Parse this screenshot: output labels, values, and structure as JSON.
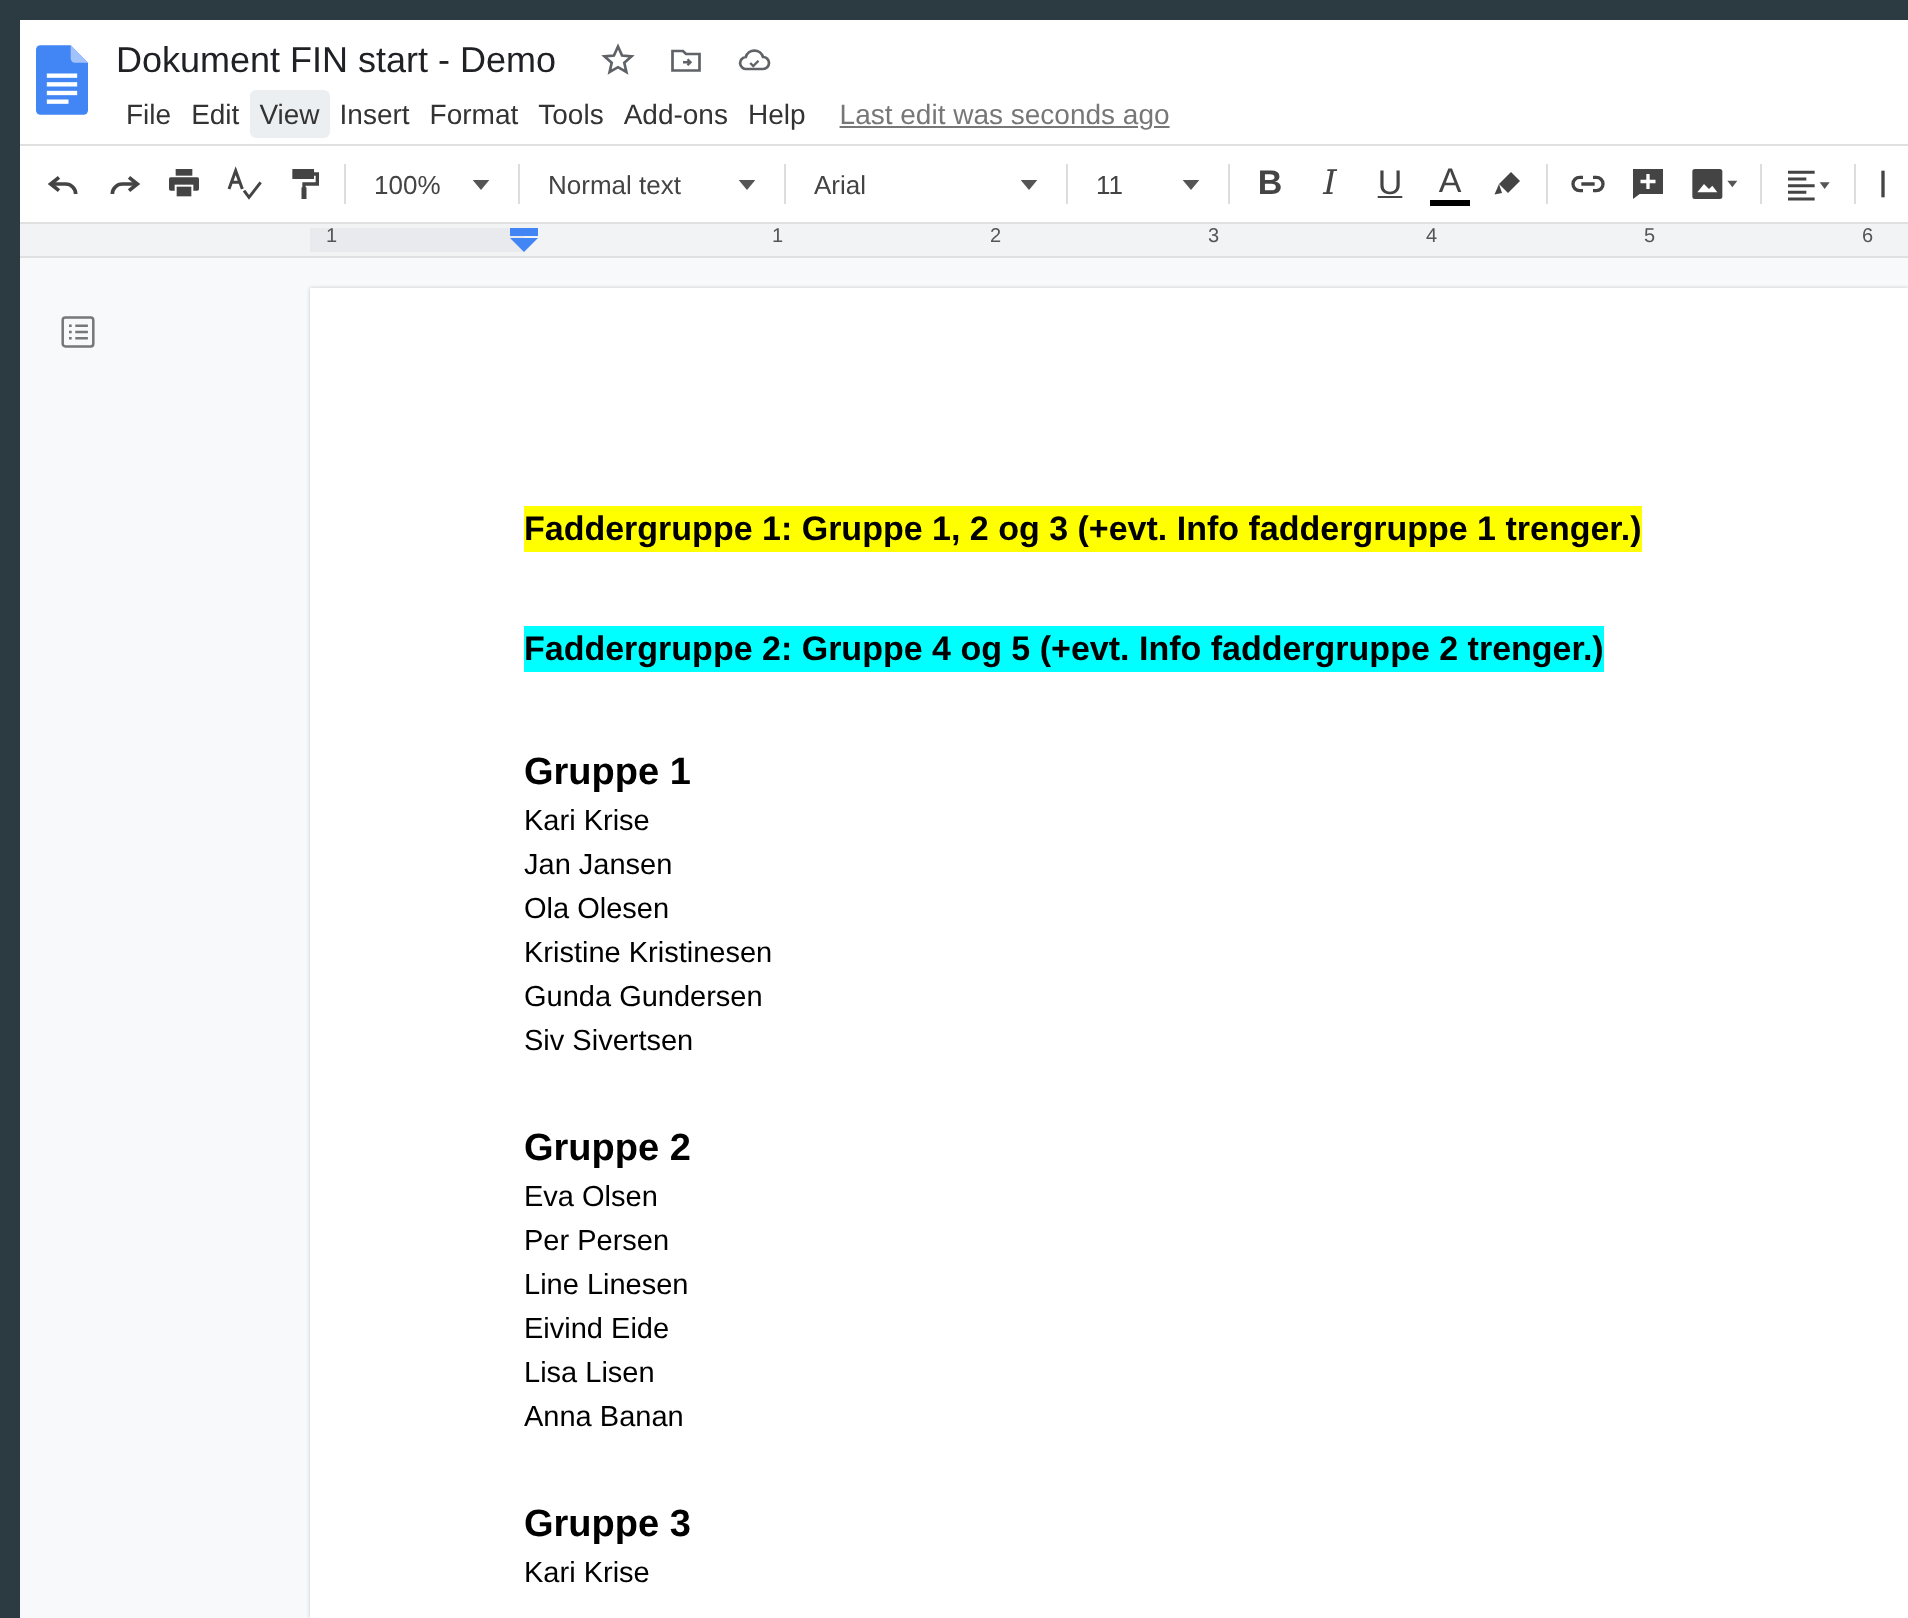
{
  "app": {
    "title": "Dokument FIN start - Demo"
  },
  "menu": [
    {
      "label": "File",
      "selected": false
    },
    {
      "label": "Edit",
      "selected": false
    },
    {
      "label": "View",
      "selected": true
    },
    {
      "label": "Insert",
      "selected": false
    },
    {
      "label": "Format",
      "selected": false
    },
    {
      "label": "Tools",
      "selected": false
    },
    {
      "label": "Add-ons",
      "selected": false
    },
    {
      "label": "Help",
      "selected": false
    }
  ],
  "last_edit": "Last edit was seconds ago",
  "toolbar": {
    "zoom": "100%",
    "style": "Normal text",
    "font": "Arial",
    "font_size": "11",
    "format_buttons": [
      "B",
      "I",
      "U",
      "A"
    ]
  },
  "ruler": {
    "labels": [
      "1",
      "1",
      "2",
      "3",
      "4",
      "5",
      "6"
    ]
  },
  "document": {
    "highlights": [
      {
        "text": "Faddergruppe 1: Gruppe 1, 2 og 3 (+evt. Info faddergruppe 1 trenger.)",
        "color": "#ffff00"
      },
      {
        "text": "Faddergruppe 2: Gruppe 4 og 5 (+evt. Info faddergruppe 2 trenger.)",
        "color": "#00ffff"
      }
    ],
    "groups": [
      {
        "title": "Gruppe 1",
        "members": [
          "Kari Krise",
          "Jan Jansen",
          "Ola Olesen",
          "Kristine Kristinesen",
          "Gunda Gundersen",
          "Siv Sivertsen"
        ]
      },
      {
        "title": "Gruppe 2",
        "members": [
          "Eva Olsen",
          "Per Persen",
          "Line Linesen",
          "Eivind Eide",
          "Lisa Lisen",
          "Anna Banan"
        ]
      },
      {
        "title": "Gruppe 3",
        "members": [
          "Kari Krise"
        ]
      }
    ]
  }
}
